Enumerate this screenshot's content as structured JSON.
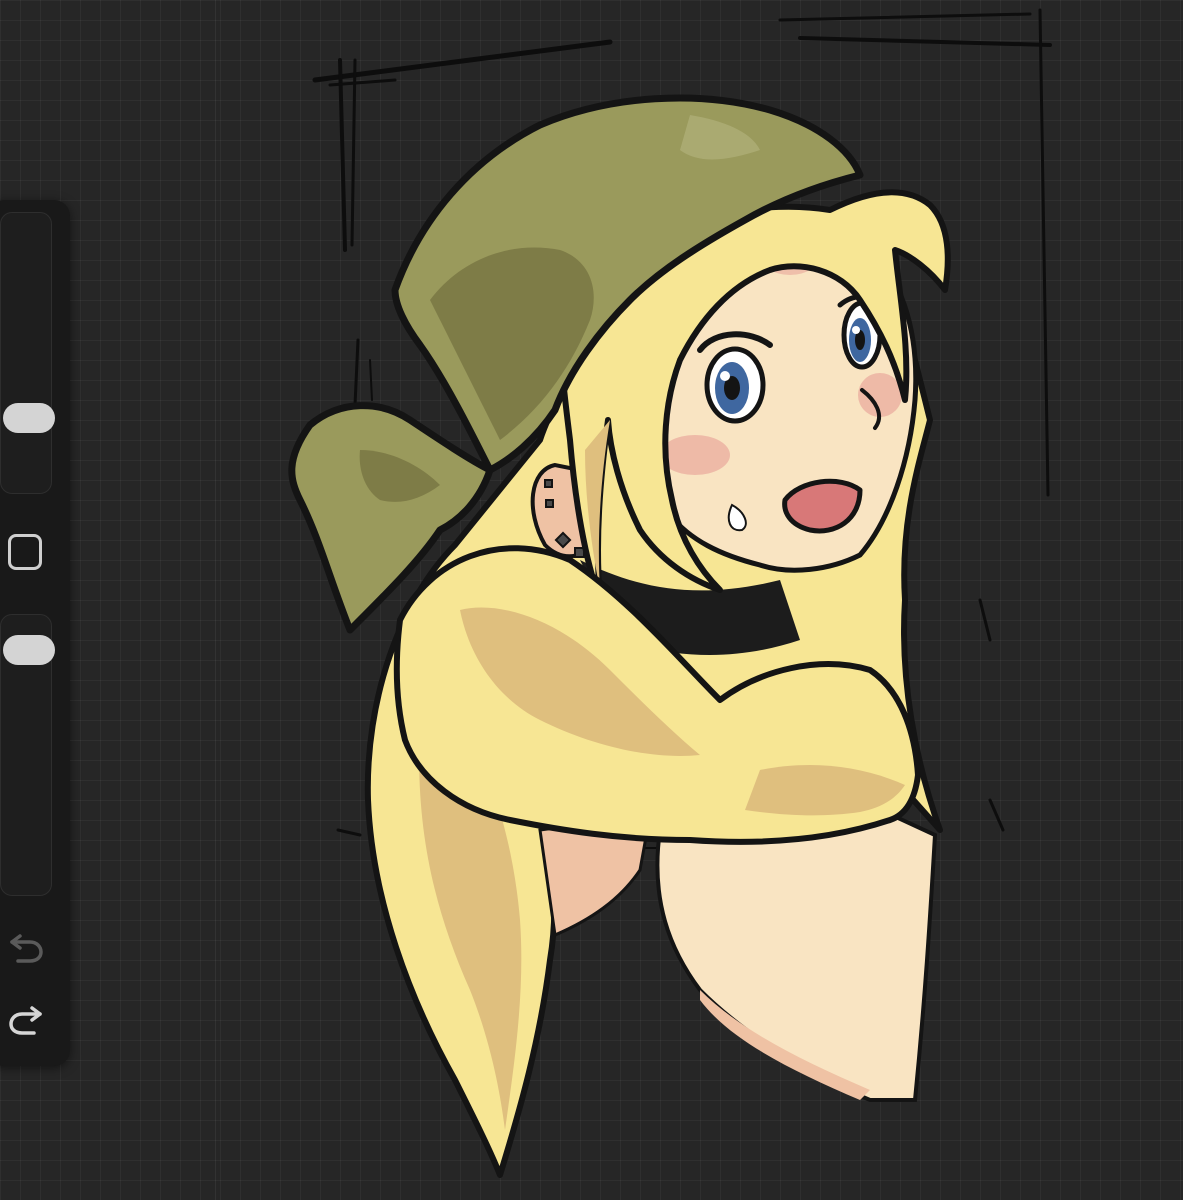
{
  "app": {
    "theme": "dark",
    "canvas_background": "#262626",
    "grid": true
  },
  "sidebar": {
    "brush_size_slider": {
      "level": 0.28
    },
    "opacity_slider": {
      "level": 0.95
    },
    "modify_button": {
      "icon": "square-icon"
    },
    "undo_button": {
      "icon": "undo-arrow-icon",
      "enabled": false
    },
    "redo_button": {
      "icon": "redo-arrow-icon",
      "enabled": true
    }
  },
  "artwork": {
    "palette": {
      "bandana": "#9a9a5c",
      "bandana_shadow": "#7e7c47",
      "hair": "#f7e694",
      "hair_shadow": "#dfbf7e",
      "skin": "#f9e4c2",
      "skin_shadow": "#efc2a4",
      "blush": "#ecb5a4",
      "eye": "#3f67a0",
      "mouth": "#d87878",
      "lineart": "#141414"
    }
  }
}
